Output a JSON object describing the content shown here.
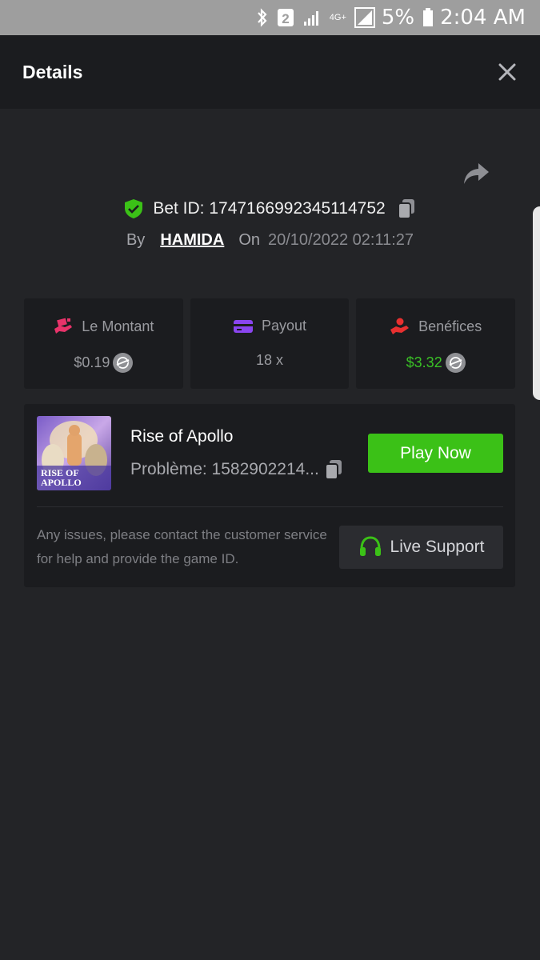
{
  "status_bar": {
    "sim": "2",
    "network": "4G+",
    "battery": "5%",
    "time": "2:04 AM"
  },
  "header": {
    "title": "Details"
  },
  "bet": {
    "id_label": "Bet ID: 1747166992345114752",
    "by_label": "By",
    "user": "HAMIDA",
    "on_label": "On",
    "date": "20/10/2022 02:11:27"
  },
  "cards": [
    {
      "label": "Le Montant",
      "value": "$0.19",
      "icon": "money-hand-icon",
      "icon_color": "#e8336a"
    },
    {
      "label": "Payout",
      "value": "18 x",
      "icon": "card-icon",
      "icon_color": "#8a45f0"
    },
    {
      "label": "Benéfices",
      "value": "$3.32",
      "icon": "profit-hand-icon",
      "icon_color": "#e83030",
      "value_color": "#3ac126"
    }
  ],
  "game": {
    "name": "Rise of Apollo",
    "thumb_text_line1": "RISE OF",
    "thumb_text_line2": "APOLLO",
    "id_label": "Problème: 1582902214...",
    "play_label": "Play Now",
    "notice": "Any issues, please contact the customer service for help and provide the game ID.",
    "support_label": "Live Support"
  },
  "colors": {
    "background": "#232427",
    "panel": "#1b1c1f",
    "accent_green": "#3bc117"
  }
}
